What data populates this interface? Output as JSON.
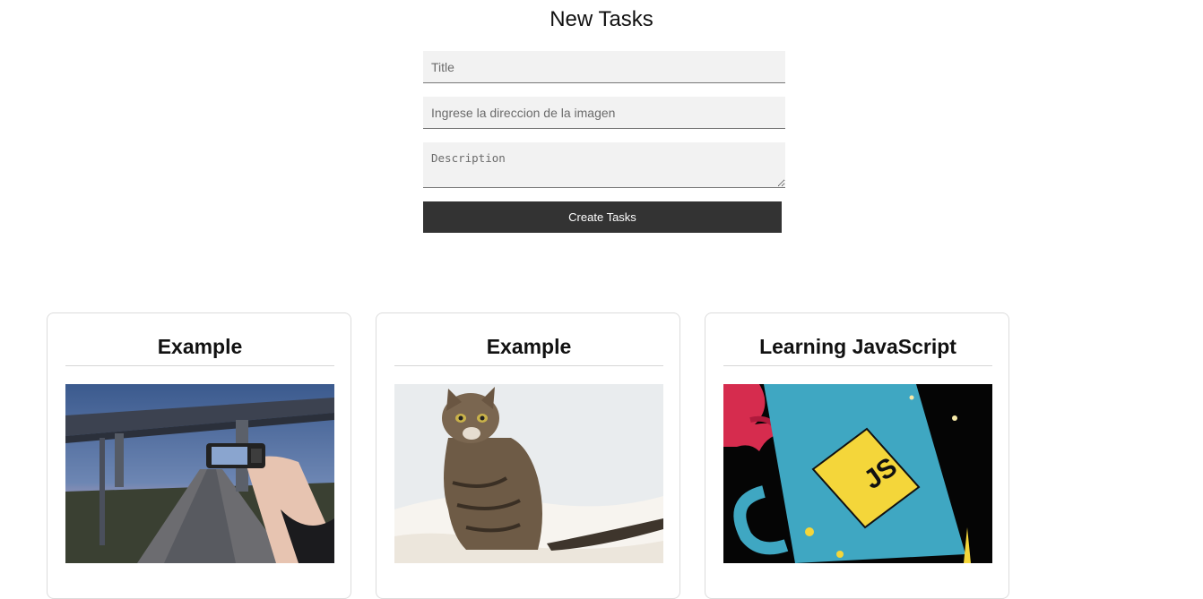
{
  "form": {
    "heading": "New Tasks",
    "title_placeholder": "Title",
    "image_placeholder": "Ingrese la direccion de la imagen",
    "description_placeholder": "Description",
    "submit_label": "Create Tasks"
  },
  "cards": [
    {
      "title": "Example",
      "image": "road-bridge-camera-photo"
    },
    {
      "title": "Example",
      "image": "tabby-cat-photo"
    },
    {
      "title": "Learning JavaScript",
      "image": "js-mug-illustration"
    }
  ],
  "colors": {
    "button_bg": "#333333",
    "input_bg": "#f2f2f2",
    "card_border": "#dcdcdc"
  }
}
